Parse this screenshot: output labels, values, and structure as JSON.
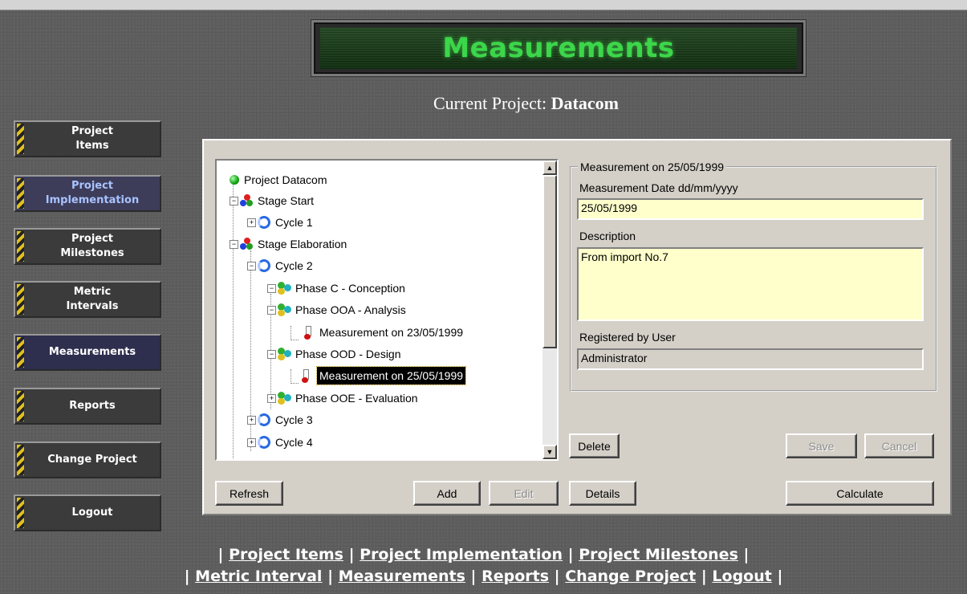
{
  "header": {
    "title": "Measurements",
    "current_project_label": "Current Project:",
    "current_project_name": "Datacom"
  },
  "nav": [
    {
      "label_line1": "Project",
      "label_line2": "Items"
    },
    {
      "label_line1": "Project",
      "label_line2": "Implementation"
    },
    {
      "label_line1": "Project",
      "label_line2": "Milestones"
    },
    {
      "label_line1": "Metric",
      "label_line2": "Intervals"
    },
    {
      "label_line1": "Measurements",
      "label_line2": ""
    },
    {
      "label_line1": "Reports",
      "label_line2": ""
    },
    {
      "label_line1": "Change Project",
      "label_line2": ""
    },
    {
      "label_line1": "Logout",
      "label_line2": ""
    }
  ],
  "tree": {
    "nodes": [
      "Project Datacom",
      "Stage Start",
      "Cycle 1",
      "Stage Elaboration",
      "Cycle 2",
      "Phase C - Conception",
      "Phase OOA - Analysis",
      "Measurement on 23/05/1999",
      "Phase OOD - Design",
      "Measurement on 25/05/1999",
      "Phase OOE - Evaluation",
      "Cycle 3",
      "Cycle 4"
    ],
    "selected": "Measurement on 25/05/1999"
  },
  "detail": {
    "group_title": "Measurement on 25/05/1999",
    "date_label": "Measurement Date   dd/mm/yyyy",
    "date_value": "25/05/1999",
    "description_label": "Description",
    "description_value": "From import No.7",
    "registered_label": "Registered by User",
    "registered_value": "Administrator"
  },
  "buttons": {
    "delete": "Delete",
    "save": "Save",
    "cancel": "Cancel",
    "refresh": "Refresh",
    "add": "Add",
    "edit": "Edit",
    "details": "Details",
    "calculate": "Calculate"
  },
  "footer": {
    "links_row1": [
      "Project Items",
      "Project Implementation",
      "Project Milestones"
    ],
    "links_row2": [
      "Metric Interval",
      "Measurements",
      "Reports",
      "Change Project",
      "Logout"
    ]
  },
  "colors": {
    "title_green": "#3cd64a",
    "date_field_bg": "#ffffcc",
    "readonly_field_bg": "#d4d0c8"
  }
}
